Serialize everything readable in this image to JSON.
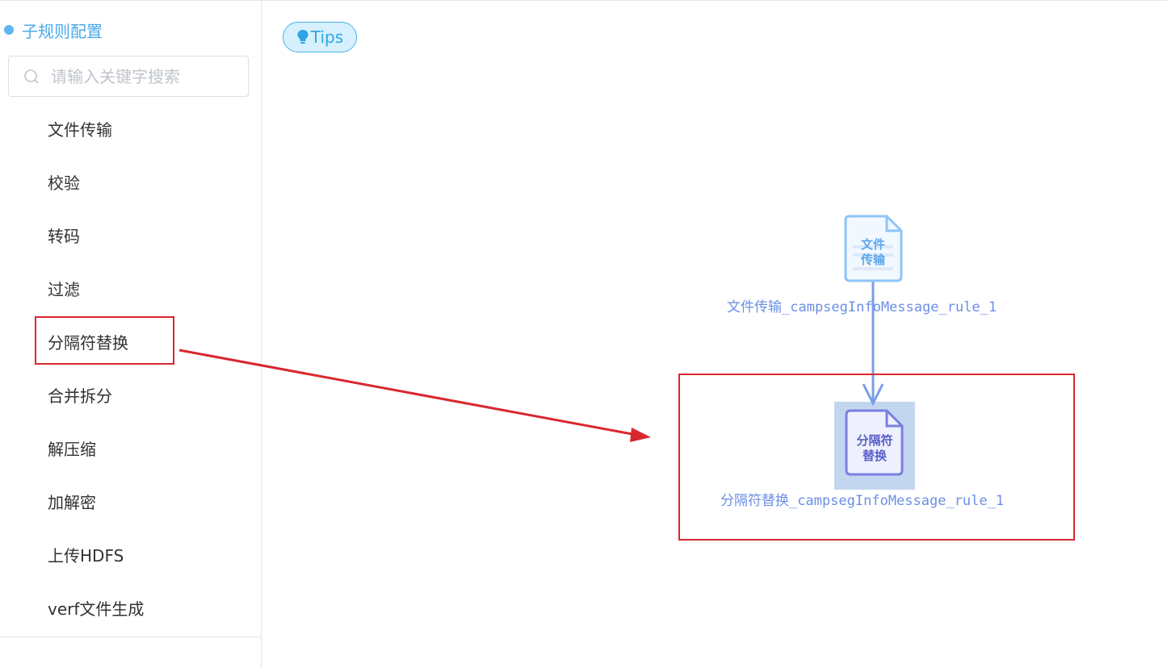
{
  "sidebar": {
    "title": "子规则配置",
    "search_placeholder": "请输入关键字搜索",
    "items": [
      {
        "label": "文件传输"
      },
      {
        "label": "校验"
      },
      {
        "label": "转码"
      },
      {
        "label": "过滤"
      },
      {
        "label": "分隔符替换"
      },
      {
        "label": "合并拆分"
      },
      {
        "label": "解压缩"
      },
      {
        "label": "加解密"
      },
      {
        "label": "上传HDFS"
      },
      {
        "label": "verf文件生成"
      }
    ]
  },
  "tips": {
    "label": "Tips"
  },
  "flow": {
    "nodes": [
      {
        "icon_text_line1": "文件",
        "icon_text_line2": "传输",
        "label": "文件传输_campsegInfoMessage_rule_1"
      },
      {
        "icon_text_line1": "分隔符",
        "icon_text_line2": "替换",
        "label": "分隔符替换_campsegInfoMessage_rule_1"
      }
    ]
  },
  "colors": {
    "accent": "#4aa9ea",
    "annotation_red": "#d9272e",
    "node_blue": "#6b8fe6",
    "node_selected": "#7b7fe0"
  }
}
